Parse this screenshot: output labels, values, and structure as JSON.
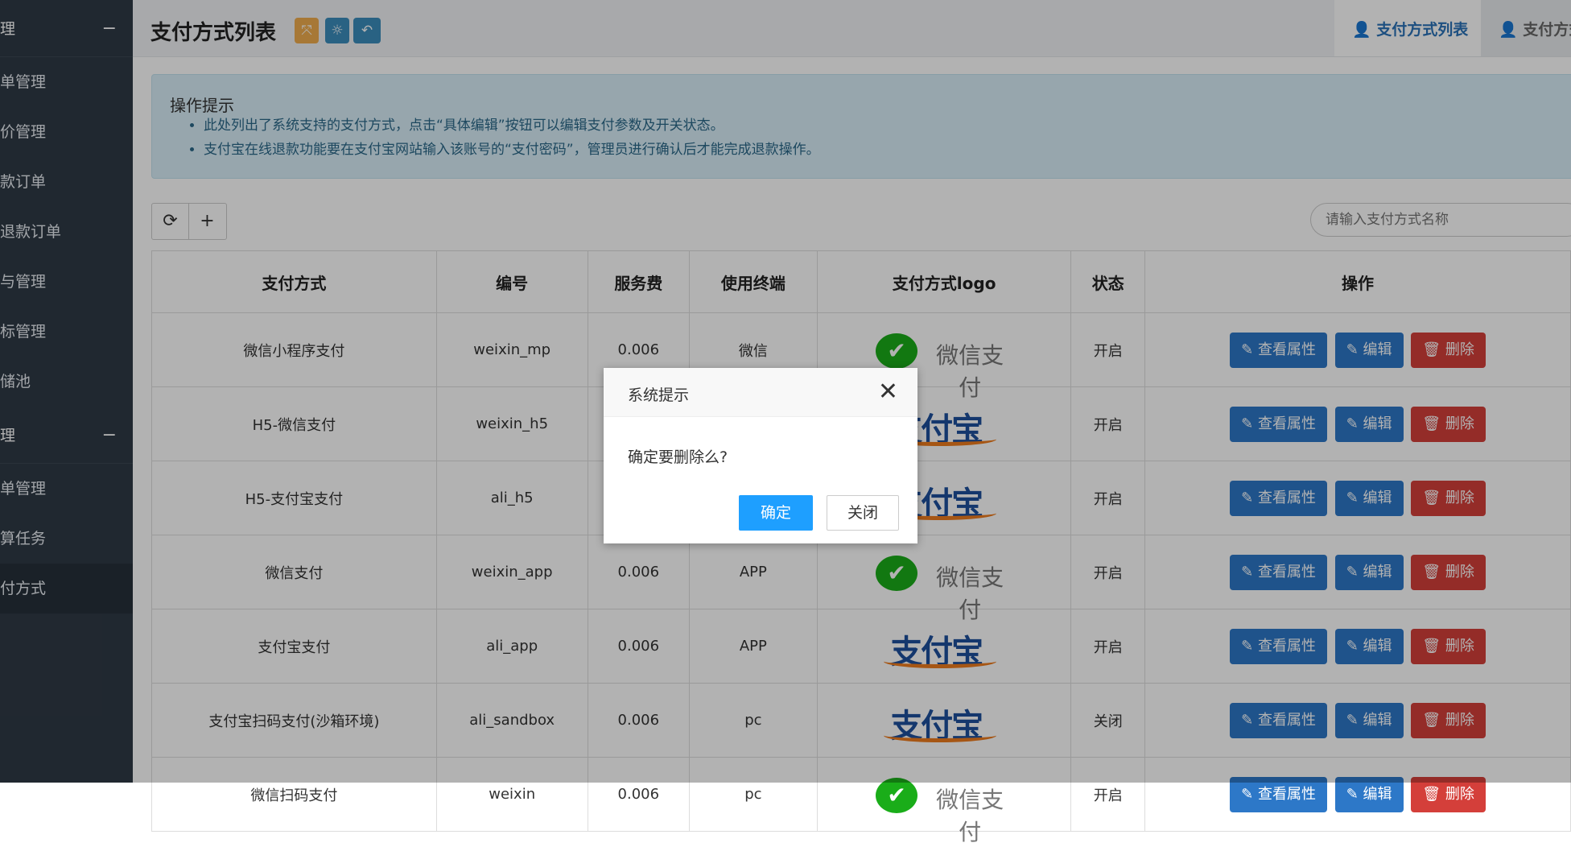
{
  "sidebar": {
    "section1": {
      "label": "理",
      "toggle": "−"
    },
    "items1": [
      "单管理",
      "价管理",
      "款订单",
      "退款订单",
      "与管理",
      "标管理",
      "储池"
    ],
    "section2": {
      "label": "理",
      "toggle": "−"
    },
    "items2": [
      "单管理",
      "算任务",
      "付方式"
    ]
  },
  "header": {
    "title": "支付方式列表",
    "tab_active": "支付方式列表",
    "tab_other": "支付方式"
  },
  "hint": {
    "title": "操作提示",
    "items": [
      "此处列出了系统支持的支付方式，点击“具体编辑”按钮可以编辑支付参数及开关状态。",
      "支付宝在线退款功能要在支付宝网站输入该账号的“支付密码”，管理员进行确认后才能完成退款操作。"
    ]
  },
  "toolbar": {
    "refresh_icon": "refresh-icon",
    "add_icon": "plus-icon"
  },
  "search": {
    "placeholder": "请输入支付方式名称"
  },
  "table": {
    "headers": [
      "支付方式",
      "编号",
      "服务费",
      "使用终端",
      "支付方式logo",
      "状态",
      "操作"
    ],
    "rows": [
      {
        "name": "微信小程序支付",
        "code": "weixin_mp",
        "fee": "0.006",
        "terminal": "微信",
        "logo": "wechat",
        "status": "开启"
      },
      {
        "name": "H5-微信支付",
        "code": "weixin_h5",
        "fee": "",
        "terminal": "",
        "logo": "alipay",
        "status": "开启"
      },
      {
        "name": "H5-支付宝支付",
        "code": "ali_h5",
        "fee": "",
        "terminal": "",
        "logo": "alipay",
        "status": "开启"
      },
      {
        "name": "微信支付",
        "code": "weixin_app",
        "fee": "0.006",
        "terminal": "APP",
        "logo": "wechat",
        "status": "开启"
      },
      {
        "name": "支付宝支付",
        "code": "ali_app",
        "fee": "0.006",
        "terminal": "APP",
        "logo": "alipay",
        "status": "开启"
      },
      {
        "name": "支付宝扫码支付(沙箱环境)",
        "code": "ali_sandbox",
        "fee": "0.006",
        "terminal": "pc",
        "logo": "alipay",
        "status": "关闭"
      },
      {
        "name": "微信扫码支付",
        "code": "weixin",
        "fee": "0.006",
        "terminal": "pc",
        "logo": "wechat",
        "status": "开启"
      }
    ],
    "btn_view": "查看属性",
    "btn_edit": "编辑",
    "btn_delete": "删除",
    "logo_wechat_text": "微信支付",
    "logo_alipay_text": "支付宝"
  },
  "dialog": {
    "title": "系统提示",
    "message": "确定要删除么?",
    "confirm": "确定",
    "close": "关闭"
  },
  "colors": {
    "primary": "#2d78c8",
    "danger": "#d43f3a",
    "dialog_ok": "#1e9fff"
  }
}
